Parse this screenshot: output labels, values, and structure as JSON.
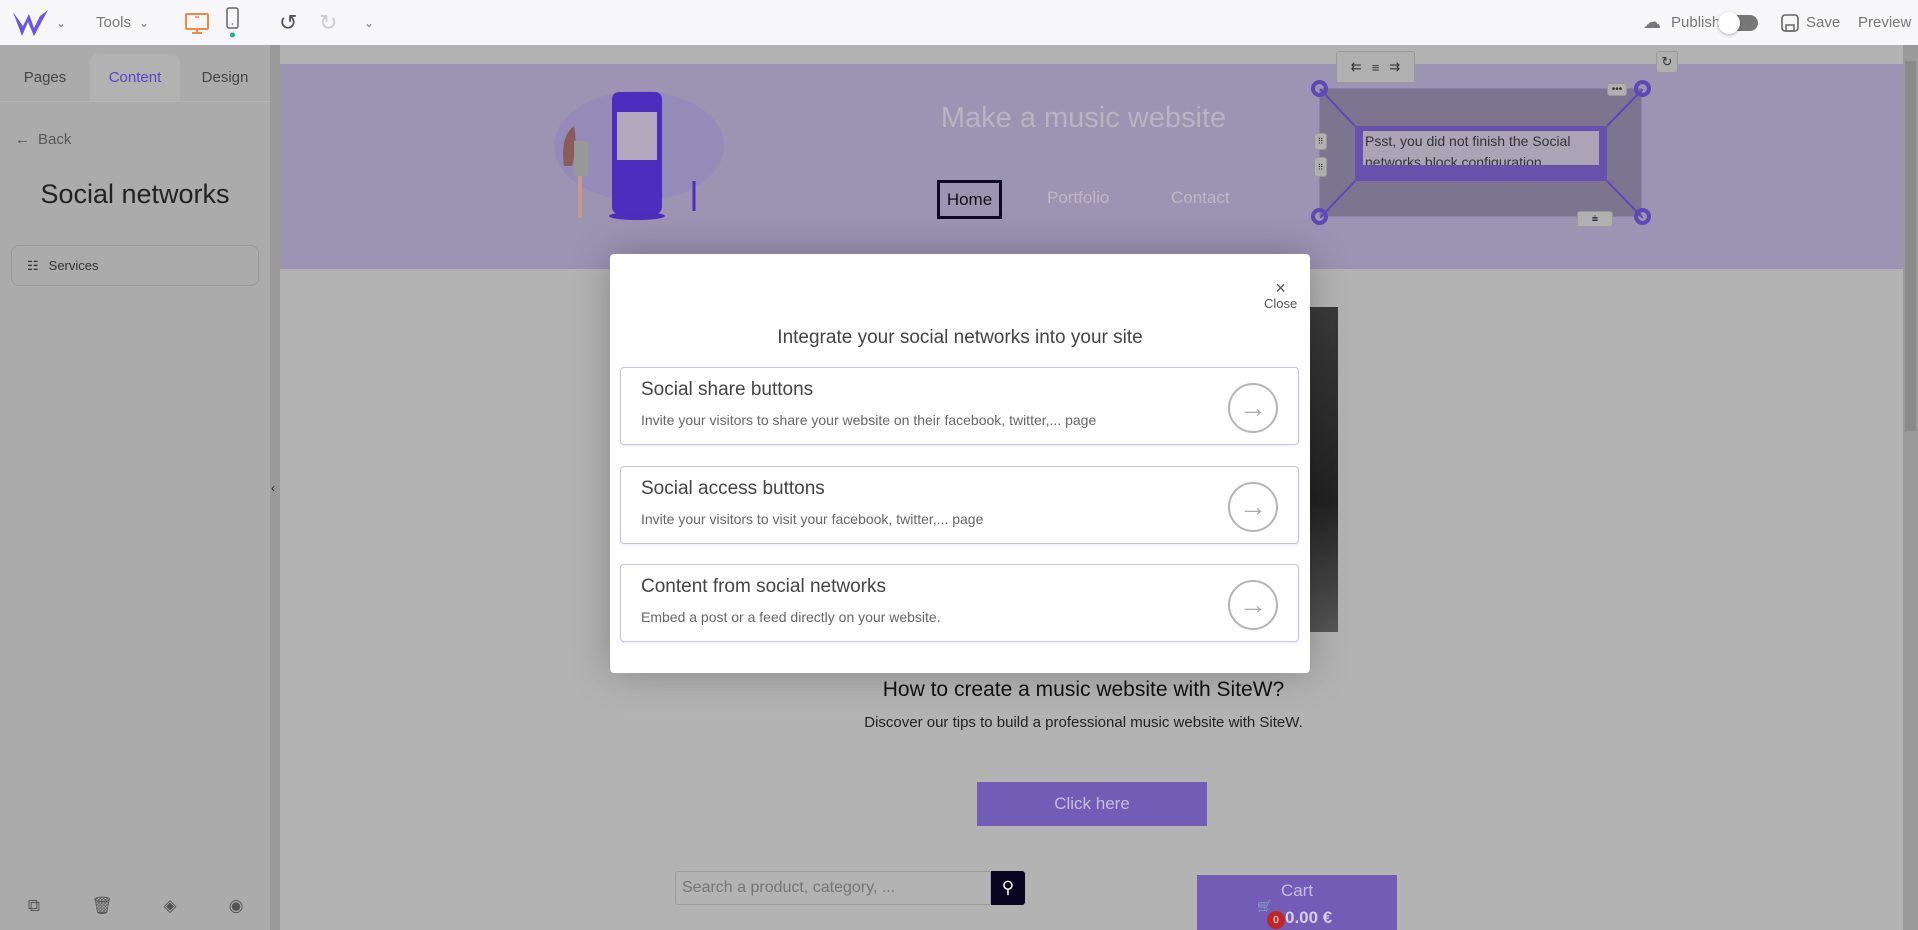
{
  "topbar": {
    "tools_label": "Tools",
    "publish_label": "Publish",
    "save_label": "Save",
    "preview_label": "Preview",
    "publish_toggle_on": false,
    "colors": {
      "logo": "#6a55e6",
      "desktop_active": "#f08a4b",
      "mobile_dot": "#1db77f"
    }
  },
  "sidebar": {
    "tabs": [
      {
        "label": "Pages"
      },
      {
        "label": "Content",
        "active": true
      },
      {
        "label": "Design"
      }
    ],
    "back_label": "Back",
    "title": "Social networks",
    "services_label": "Services",
    "bottom_icons": [
      "duplicate-icon",
      "trash-icon",
      "layers-icon",
      "eye-icon"
    ]
  },
  "site": {
    "title": "Make a music website",
    "nav": [
      "Home",
      "Portfolio",
      "Contact"
    ],
    "social_block_text": "Psst, you did not finish the Social networks block configuration",
    "heading": "How to create a music website with SiteW?",
    "subheading": "Discover our tips to build a professional music website with SiteW.",
    "cta_label": "Click here",
    "search_placeholder": "Search a product, category, ...",
    "cart_label": "Cart",
    "cart_count": "0",
    "cart_total": "0.00 €",
    "accent": "#735cb6"
  },
  "modal": {
    "close_label": "Close",
    "title": "Integrate your social networks into your site",
    "options": [
      {
        "title": "Social share buttons",
        "description": "Invite your visitors to share your website on their facebook, twitter,... page"
      },
      {
        "title": "Social access buttons",
        "description": "Invite your visitors to visit your facebook, twitter,... page"
      },
      {
        "title": "Content from social networks",
        "description": "Embed a post or a feed directly on your website."
      }
    ]
  }
}
